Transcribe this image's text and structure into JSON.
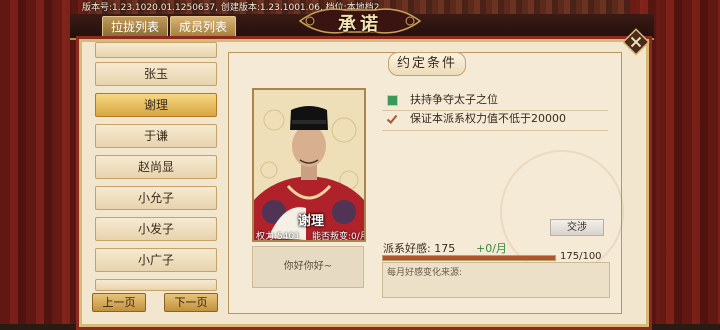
{
  "version_info": "版本号:1.23.1020.01.1250637,  创建版本:1.23.1001.06,  档位:本地档2",
  "tabs": [
    {
      "label": "拉拢列表",
      "active": false
    },
    {
      "label": "成员列表",
      "active": true
    }
  ],
  "title": "承诺",
  "members": [
    {
      "name": "张玉",
      "selected": false
    },
    {
      "name": "谢理",
      "selected": true
    },
    {
      "name": "于谦",
      "selected": false
    },
    {
      "name": "赵尚显",
      "selected": false
    },
    {
      "name": "小允子",
      "selected": false
    },
    {
      "name": "小发子",
      "selected": false
    },
    {
      "name": "小广子",
      "selected": false
    }
  ],
  "pagination": {
    "prev": "上一页",
    "next": "下一页"
  },
  "conditions_title": "约定条件",
  "conditions": [
    {
      "icon": "green-square-icon",
      "text": "扶持争夺太子之位"
    },
    {
      "icon": "check-icon",
      "text": "保证本派系权力值不低于20000"
    }
  ],
  "portrait": {
    "name": "谢理",
    "stat_left": "权力:5401",
    "stat_right": "能否叛变:0/月"
  },
  "greeting": "你好你好~",
  "exchange_button": "交涉",
  "favor": {
    "label": "派系好感:  175",
    "rate": "+0/月",
    "ratio": "175/100",
    "fraction": 1.0
  },
  "source_label": "每月好感变化来源:",
  "colors": {
    "accent": "#8c2a1f",
    "gold": "#d8a640",
    "favor_fill": "#b0542a"
  }
}
